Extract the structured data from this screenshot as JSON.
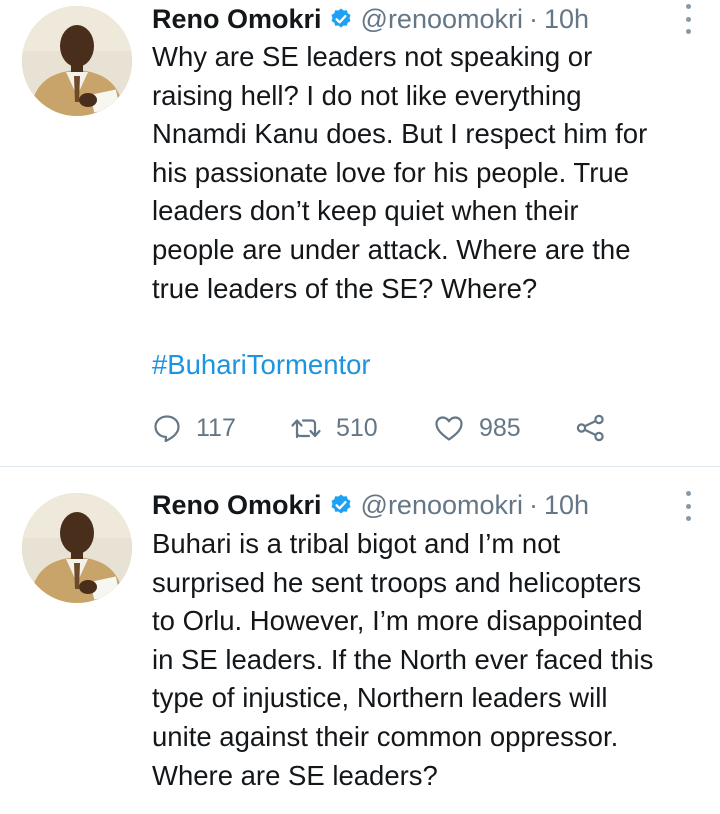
{
  "tweets": [
    {
      "author_name": "Reno Omokri",
      "handle": "@renoomokri",
      "separator": "·",
      "time": "10h",
      "text_lines": [
        "Why are SE leaders not speaking or",
        "raising hell? I do not like everything",
        "Nnamdi Kanu does. But I respect him for",
        "his passionate love for his people. True",
        "leaders don’t keep quiet when their",
        "people are under attack. Where are the",
        "true leaders of the SE? Where?"
      ],
      "hashtag": "#BuhariTormentor",
      "replies": "117",
      "retweets": "510",
      "likes": "985"
    },
    {
      "author_name": "Reno Omokri",
      "handle": "@renoomokri",
      "separator": "·",
      "time": "10h",
      "text_lines": [
        "Buhari is a tribal bigot and I’m not",
        "surprised he sent troops and helicopters",
        "to Orlu. However, I’m more disappointed",
        "in SE leaders. If the North ever faced this",
        "type of injustice, Northern leaders will",
        "unite against their common oppressor.",
        "Where are SE leaders?"
      ]
    }
  ],
  "icons": {
    "verified": "verified-badge-icon",
    "more": "more-options-icon",
    "reply": "reply-icon",
    "retweet": "retweet-icon",
    "like": "like-icon",
    "share": "share-icon"
  },
  "colors": {
    "accent": "#1da1f2",
    "hashtag": "#1b95e0",
    "secondary_text": "#657786",
    "divider": "#e1e8ed"
  }
}
